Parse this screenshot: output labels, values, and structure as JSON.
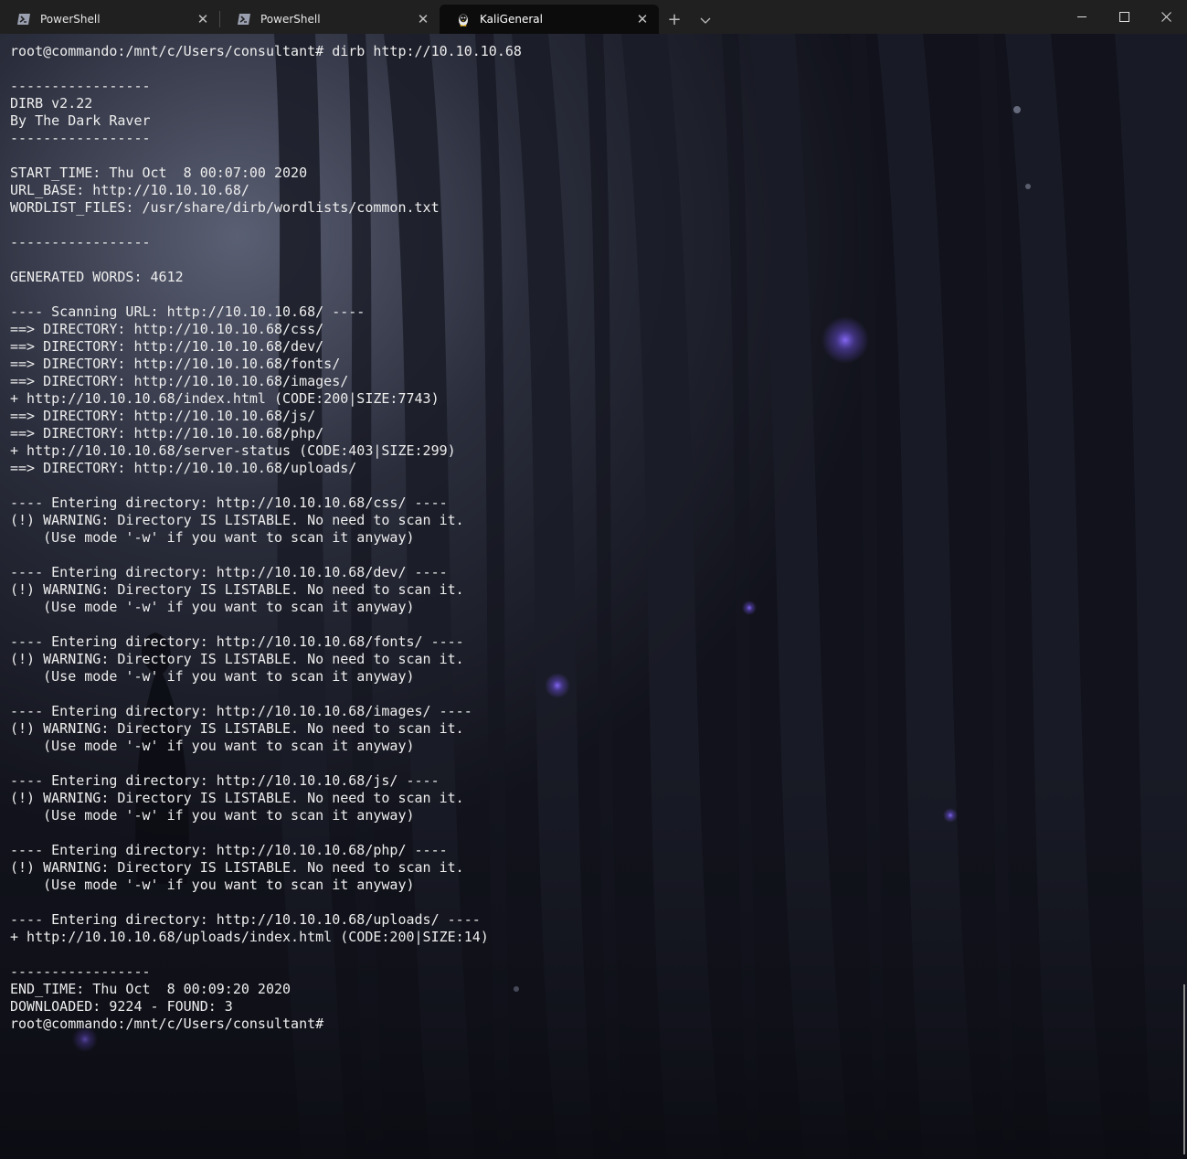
{
  "tabs": [
    {
      "label": "PowerShell",
      "icon": "powershell-icon",
      "active": false
    },
    {
      "label": "PowerShell",
      "icon": "powershell-icon",
      "active": false
    },
    {
      "label": "KaliGeneral",
      "icon": "kali-icon",
      "active": true
    }
  ],
  "tab_controls": {
    "new_tab": "+",
    "dropdown": "⌄",
    "close": "✕"
  },
  "window_controls": {
    "minimize": "minimize-icon",
    "maximize": "maximize-icon",
    "close": "close-icon"
  },
  "colors": {
    "tabbar": "#202020",
    "active_tab": "#0c0c0c",
    "text": "#eeeeee",
    "accent_glow": "#6a4fd8"
  },
  "terminal": {
    "lines": [
      "root@commando:/mnt/c/Users/consultant# dirb http://10.10.10.68",
      "",
      "-----------------",
      "DIRB v2.22",
      "By The Dark Raver",
      "-----------------",
      "",
      "START_TIME: Thu Oct  8 00:07:00 2020",
      "URL_BASE: http://10.10.10.68/",
      "WORDLIST_FILES: /usr/share/dirb/wordlists/common.txt",
      "",
      "-----------------",
      "",
      "GENERATED WORDS: 4612",
      "",
      "---- Scanning URL: http://10.10.10.68/ ----",
      "==> DIRECTORY: http://10.10.10.68/css/",
      "==> DIRECTORY: http://10.10.10.68/dev/",
      "==> DIRECTORY: http://10.10.10.68/fonts/",
      "==> DIRECTORY: http://10.10.10.68/images/",
      "+ http://10.10.10.68/index.html (CODE:200|SIZE:7743)",
      "==> DIRECTORY: http://10.10.10.68/js/",
      "==> DIRECTORY: http://10.10.10.68/php/",
      "+ http://10.10.10.68/server-status (CODE:403|SIZE:299)",
      "==> DIRECTORY: http://10.10.10.68/uploads/",
      "",
      "---- Entering directory: http://10.10.10.68/css/ ----",
      "(!) WARNING: Directory IS LISTABLE. No need to scan it.",
      "    (Use mode '-w' if you want to scan it anyway)",
      "",
      "---- Entering directory: http://10.10.10.68/dev/ ----",
      "(!) WARNING: Directory IS LISTABLE. No need to scan it.",
      "    (Use mode '-w' if you want to scan it anyway)",
      "",
      "---- Entering directory: http://10.10.10.68/fonts/ ----",
      "(!) WARNING: Directory IS LISTABLE. No need to scan it.",
      "    (Use mode '-w' if you want to scan it anyway)",
      "",
      "---- Entering directory: http://10.10.10.68/images/ ----",
      "(!) WARNING: Directory IS LISTABLE. No need to scan it.",
      "    (Use mode '-w' if you want to scan it anyway)",
      "",
      "---- Entering directory: http://10.10.10.68/js/ ----",
      "(!) WARNING: Directory IS LISTABLE. No need to scan it.",
      "    (Use mode '-w' if you want to scan it anyway)",
      "",
      "---- Entering directory: http://10.10.10.68/php/ ----",
      "(!) WARNING: Directory IS LISTABLE. No need to scan it.",
      "    (Use mode '-w' if you want to scan it anyway)",
      "",
      "---- Entering directory: http://10.10.10.68/uploads/ ----",
      "+ http://10.10.10.68/uploads/index.html (CODE:200|SIZE:14)",
      "",
      "-----------------",
      "END_TIME: Thu Oct  8 00:09:20 2020",
      "DOWNLOADED: 9224 - FOUND: 3",
      "root@commando:/mnt/c/Users/consultant#"
    ]
  }
}
